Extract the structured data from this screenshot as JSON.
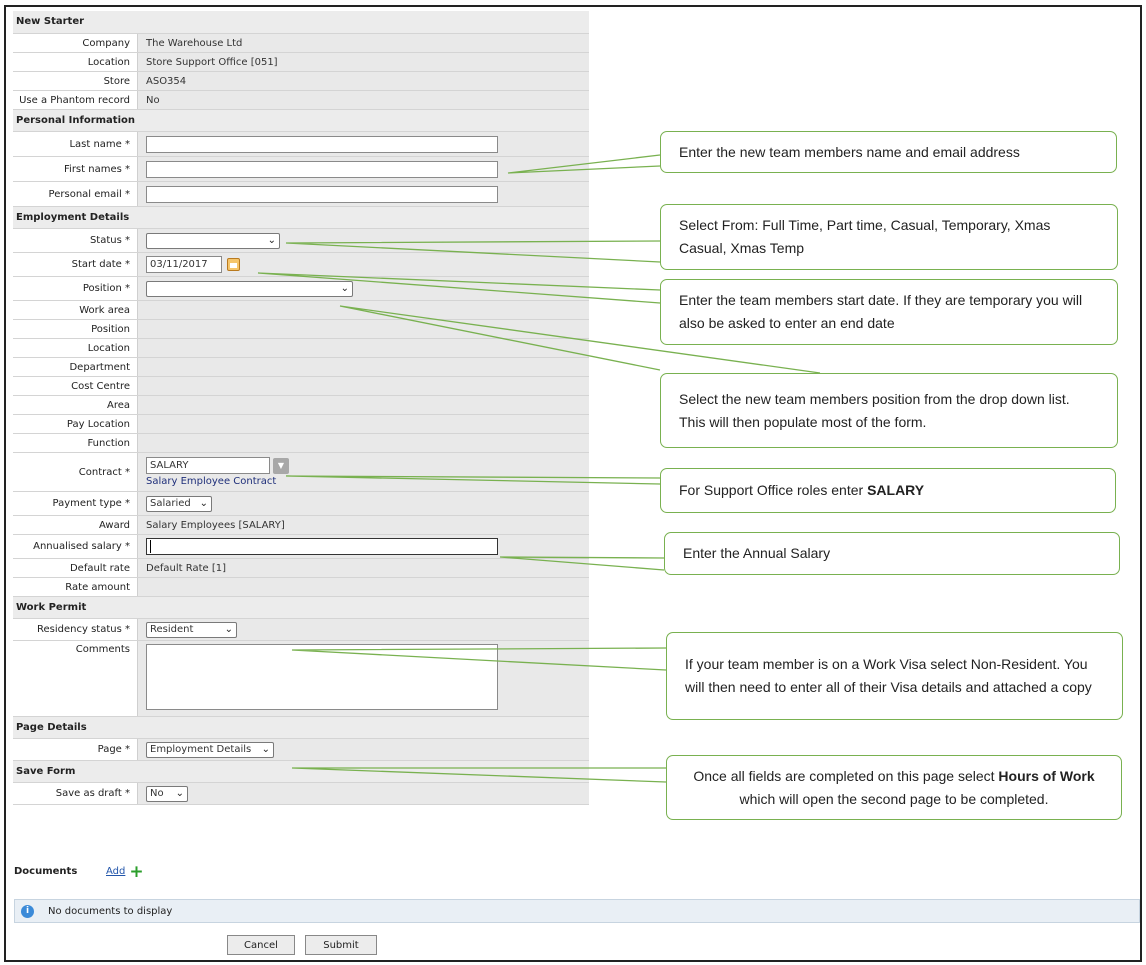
{
  "form": {
    "new_starter": {
      "heading": "New Starter",
      "rows": [
        {
          "label": "Company",
          "value": "The Warehouse Ltd"
        },
        {
          "label": "Location",
          "value": "Store Support Office [051]"
        },
        {
          "label": "Store",
          "value": "ASO354"
        },
        {
          "label": "Use a Phantom record",
          "value": "No"
        }
      ]
    },
    "personal": {
      "heading": "Personal Information",
      "last_name_label": "Last name *",
      "first_names_label": "First names *",
      "email_label": "Personal email *"
    },
    "employment": {
      "heading": "Employment Details",
      "status_label": "Status *",
      "start_date_label": "Start date *",
      "start_date_value": "03/11/2017",
      "position_label": "Position *",
      "work_area_label": "Work area",
      "position2_label": "Position",
      "location_label": "Location",
      "department_label": "Department",
      "cost_centre_label": "Cost Centre",
      "area_label": "Area",
      "pay_location_label": "Pay Location",
      "function_label": "Function",
      "contract_label": "Contract *",
      "contract_value": "SALARY",
      "contract_desc": "Salary Employee Contract",
      "payment_type_label": "Payment type *",
      "payment_type_value": "Salaried",
      "award_label": "Award",
      "award_value": "Salary Employees [SALARY]",
      "salary_label": "Annualised salary *",
      "default_rate_label": "Default rate",
      "default_rate_value": "Default Rate [1]",
      "rate_amount_label": "Rate amount"
    },
    "work_permit": {
      "heading": "Work Permit",
      "residency_label": "Residency status *",
      "residency_value": "Resident",
      "comments_label": "Comments"
    },
    "page_details": {
      "heading": "Page Details",
      "page_label": "Page *",
      "page_value": "Employment Details"
    },
    "save_form": {
      "heading": "Save Form",
      "draft_label": "Save as draft *",
      "draft_value": "No"
    }
  },
  "documents": {
    "title": "Documents",
    "add_label": "Add",
    "empty_message": "No documents to display"
  },
  "buttons": {
    "cancel": "Cancel",
    "submit": "Submit"
  },
  "callouts": {
    "name_email": "Enter the new team members name and email address",
    "status": "Select From: Full Time, Part time, Casual, Temporary, Xmas Casual, Xmas Temp",
    "start_date": "Enter the team members start date. If they are temporary you will also be asked to enter an end date",
    "position": "Select the new team members position from the drop down list. This will then populate most of the form.",
    "contract_prefix": "For Support Office roles enter ",
    "contract_bold": "SALARY",
    "salary": "Enter the Annual Salary",
    "residency": "If your team member is on a Work Visa select  Non-Resident. You will then need to enter all of their Visa details and attached a copy",
    "page_prefix": "Once all fields are completed on this page select ",
    "page_bold": "Hours of Work",
    "page_suffix": " which will open the second page to be completed."
  },
  "colors": {
    "callout_border": "#79b150",
    "section_bg": "#ececec",
    "value_bg": "#e9e9e9",
    "link": "#2255aa"
  }
}
